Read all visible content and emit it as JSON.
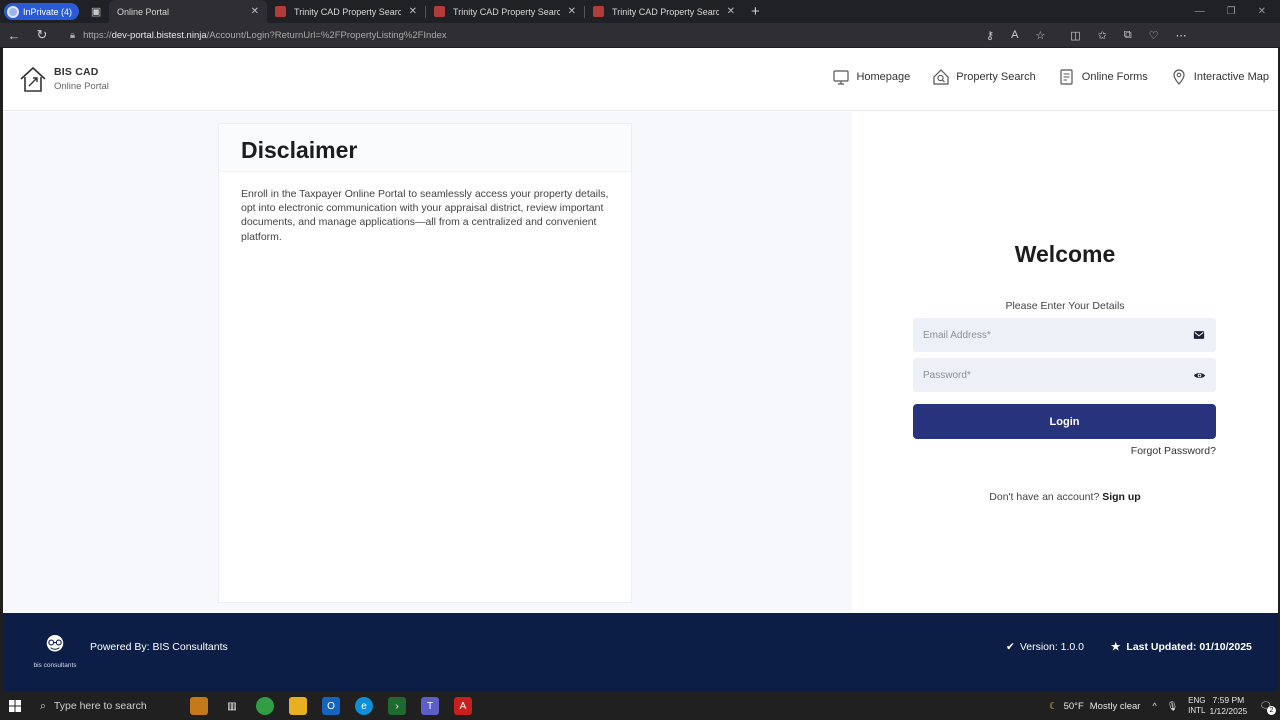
{
  "browser": {
    "inprivate_label": "InPrivate (4)",
    "tabs": [
      {
        "title": "Online Portal",
        "active": true
      },
      {
        "title": "Trinity CAD Property Search",
        "active": false
      },
      {
        "title": "Trinity CAD Property Search",
        "active": false
      },
      {
        "title": "Trinity CAD Property Search",
        "active": false
      }
    ],
    "url_prefix": "https://",
    "url_host": "dev-portal.bistest.ninja",
    "url_path": "/Account/Login?ReturnUrl=%2FPropertyListing%2FIndex"
  },
  "header": {
    "brand_title": "BIS CAD",
    "brand_subtitle": "Online Portal",
    "nav": [
      {
        "label": "Homepage",
        "icon": "monitor-icon"
      },
      {
        "label": "Property Search",
        "icon": "search-house-icon"
      },
      {
        "label": "Online Forms",
        "icon": "form-icon"
      },
      {
        "label": "Interactive Map",
        "icon": "map-pin-icon"
      }
    ]
  },
  "disclaimer": {
    "title": "Disclaimer",
    "body": "Enroll in the Taxpayer Online Portal to seamlessly access your property details, opt into electronic communication with your appraisal district, review important documents, and manage applications—all from a centralized and convenient platform."
  },
  "login": {
    "title": "Welcome",
    "subtitle": "Please Enter Your Details",
    "email_placeholder": "Email Address*",
    "password_placeholder": "Password*",
    "button_label": "Login",
    "forgot_label": "Forgot Password?",
    "signup_prompt": "Don't have an account?",
    "signup_link": "Sign up",
    "accent_color": "#28337e"
  },
  "footer": {
    "logo_caption": "bis consultants",
    "powered_by": "Powered By: BIS Consultants",
    "version": "Version: 1.0.0",
    "last_updated": "Last Updated: 01/10/2025",
    "background_color": "#0c1e46"
  },
  "taskbar": {
    "search_placeholder": "Type here to search",
    "weather_temp": "50°F",
    "weather_desc": "Mostly clear",
    "lang_top": "ENG",
    "lang_bottom": "INTL",
    "time": "7:59 PM",
    "date": "1/12/2025",
    "notification_count": "2"
  }
}
